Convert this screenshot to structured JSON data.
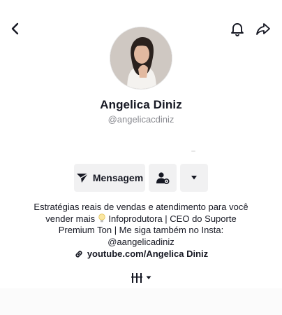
{
  "profile": {
    "name": "Angelica Diniz",
    "handle": "@angelicacdiniz",
    "bio_line1": "Estratégias reais de vendas e atendimento para você",
    "bio_line2_prefix": "vender mais",
    "bio_line2_suffix": "Infoprodutora | CEO do Suporte",
    "bio_line3": "Premium Ton | Me siga também no Insta:",
    "bio_line4": "@aangelicadiniz",
    "link": "youtube.com/Angelica Diniz"
  },
  "actions": {
    "message_label": "Mensagem"
  },
  "icons": {
    "back": "chevron-left-icon",
    "notifications": "bell-icon",
    "share": "share-arrow-icon",
    "message": "send-icon",
    "add_friend": "user-settings-icon",
    "more": "caret-down-icon",
    "link": "link-icon",
    "tab_grid": "grid-lines-icon",
    "lightbulb": "lightbulb-icon"
  },
  "colors": {
    "text_primary": "#161823",
    "text_secondary": "#8a8b91",
    "button_bg": "#f1f1f2"
  }
}
